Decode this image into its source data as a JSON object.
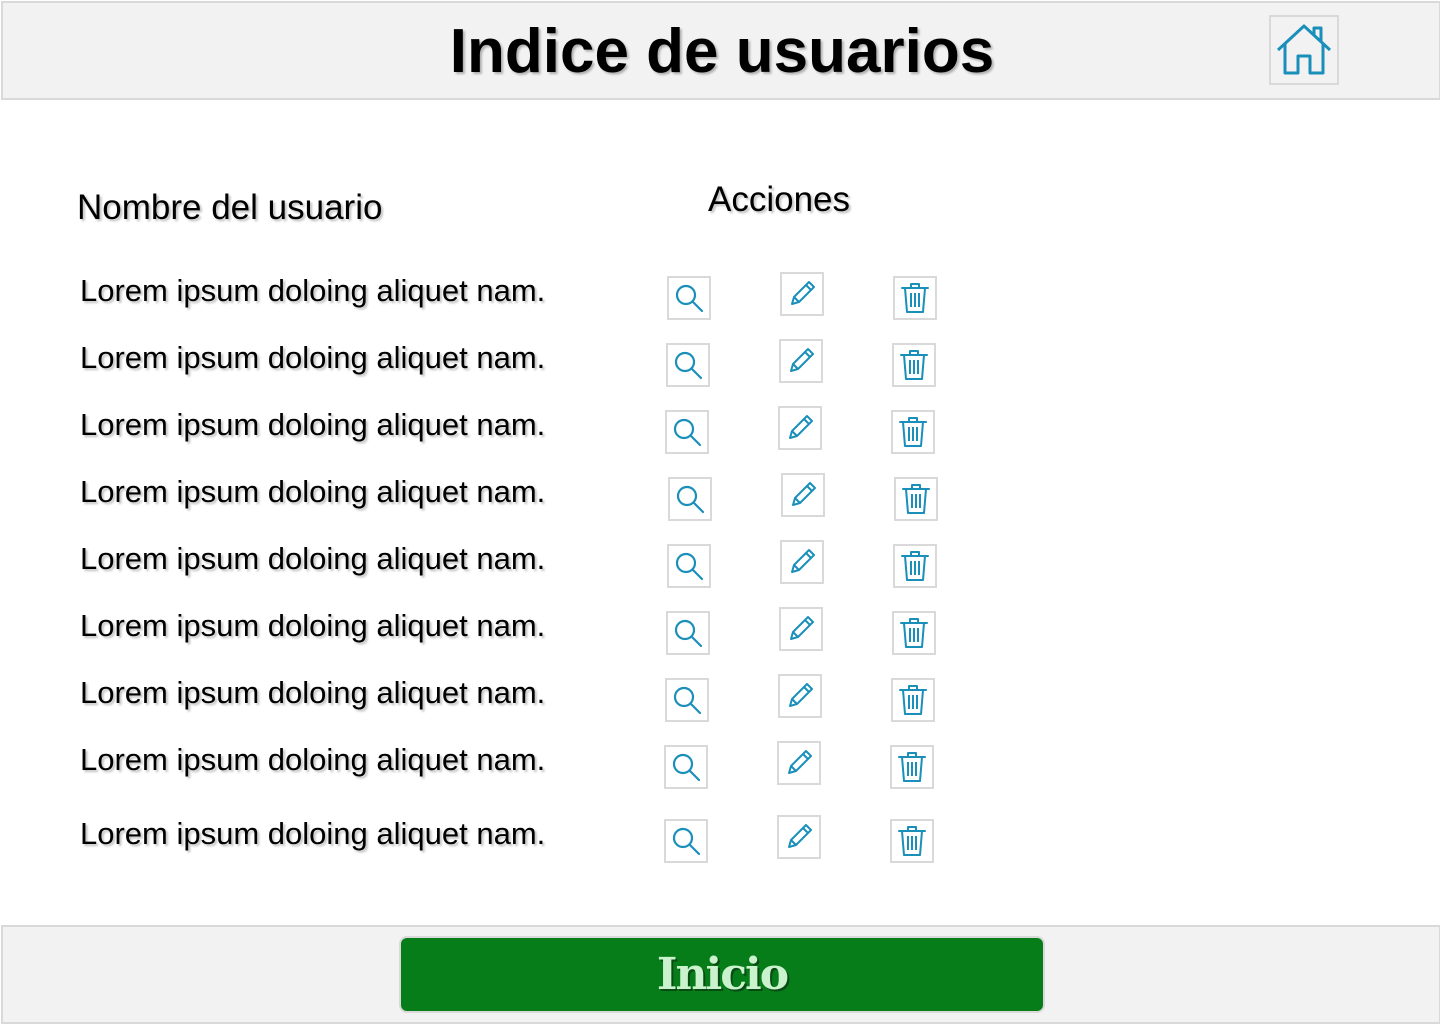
{
  "header": {
    "title": "Indice de usuarios",
    "home_icon": "home-icon"
  },
  "table": {
    "name_header": "Nombre del usuario",
    "actions_header": "Acciones",
    "rows": [
      {
        "name": "Lorem ipsum doloing aliquet nam."
      },
      {
        "name": "Lorem ipsum doloing aliquet nam."
      },
      {
        "name": "Lorem ipsum doloing aliquet nam."
      },
      {
        "name": "Lorem ipsum doloing aliquet nam."
      },
      {
        "name": "Lorem ipsum doloing aliquet nam."
      },
      {
        "name": "Lorem ipsum doloing aliquet nam."
      },
      {
        "name": "Lorem ipsum doloing aliquet nam."
      },
      {
        "name": "Lorem ipsum doloing aliquet nam."
      },
      {
        "name": "Lorem ipsum doloing aliquet nam."
      }
    ],
    "action_icons": [
      "search-icon",
      "pencil-icon",
      "trash-icon"
    ]
  },
  "footer": {
    "inicio_label": "Inicio"
  },
  "colors": {
    "icon_accent": "#1a8fba",
    "inicio_button": "#077d1a",
    "inicio_text": "#c9f2cd",
    "bar_background": "#f2f2f2",
    "border": "#d9d9d9"
  }
}
